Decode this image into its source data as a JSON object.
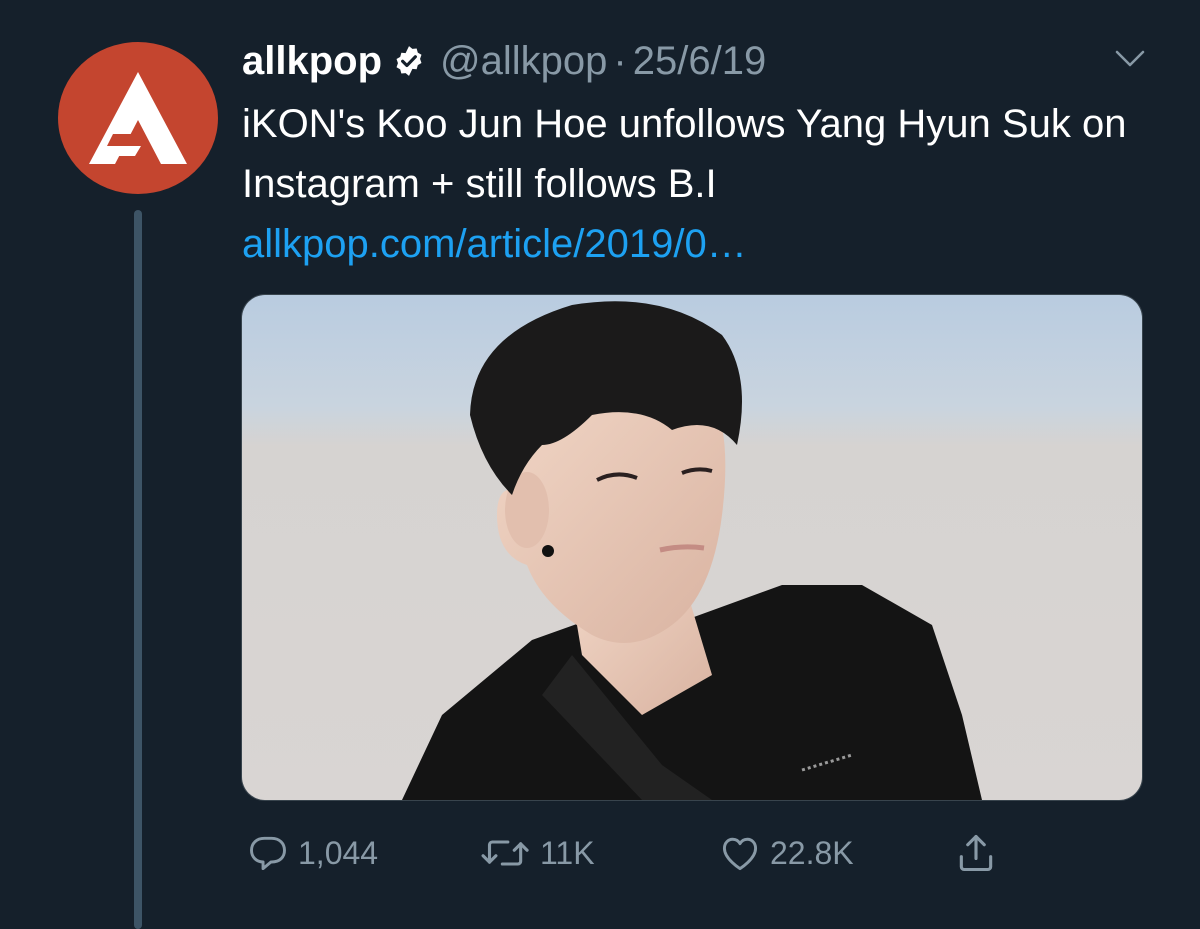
{
  "tweet": {
    "display_name": "allkpop",
    "handle": "@allkpop",
    "separator": "·",
    "date": "25/6/19",
    "text": "iKON's Koo Jun Hoe unfollows Yang Hyun Suk on Instagram + still follows B.I",
    "link": "allkpop.com/article/2019/0…"
  },
  "actions": {
    "reply_count": "1,044",
    "retweet_count": "11K",
    "like_count": "22.8K"
  },
  "icons": {
    "avatar": "allkpop-logo-icon",
    "verified": "verified-badge-icon",
    "caret": "chevron-down-icon",
    "reply": "reply-icon",
    "retweet": "retweet-icon",
    "like": "heart-icon",
    "share": "share-icon"
  },
  "colors": {
    "background": "#15202b",
    "link": "#1da1f2",
    "secondary_text": "#8899a6",
    "avatar_brand": "#c4452f"
  }
}
